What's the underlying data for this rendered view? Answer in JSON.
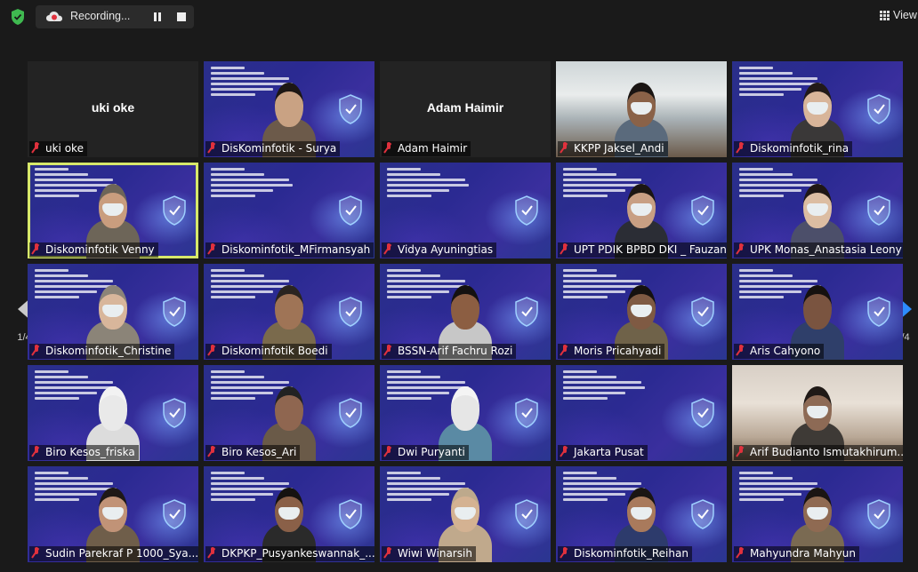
{
  "recording": {
    "label": "Recording..."
  },
  "view": {
    "label": "View"
  },
  "pagination": {
    "current": "1/4"
  },
  "tiles": [
    {
      "name": "uki oke",
      "center_name": "uki oke",
      "bg": "plain"
    },
    {
      "name": "DisKominfotik - Surya",
      "bg": "banner",
      "person": {
        "skin": "#c9a283",
        "hair": "#1d1714",
        "shirt": "#6c5a4a",
        "mask": false
      }
    },
    {
      "name": "Adam Haimir",
      "center_name": "Adam Haimir",
      "bg": "plain"
    },
    {
      "name": "KKPP Jaksel_Andi",
      "bg": "office",
      "person": {
        "skin": "#8a6248",
        "hair": "#1a1513",
        "shirt": "#5a6a7c",
        "mask": true
      }
    },
    {
      "name": "Diskominfotik_rina",
      "bg": "banner",
      "person": {
        "skin": "#d8b59a",
        "hair": "#221a18",
        "shirt": "#3a3838",
        "mask": true
      }
    },
    {
      "name": "Diskominfotik Venny",
      "bg": "banner",
      "selected": true,
      "person": {
        "skin": "#c99d7e",
        "hair": "#6d6558",
        "shirt": "#6d6558",
        "mask": true
      }
    },
    {
      "name": "Diskominfotik_MFirmansyah",
      "bg": "banner"
    },
    {
      "name": "Vidya Ayuningtias",
      "bg": "banner"
    },
    {
      "name": "UPT PDIK BPBD DKI _ Fauzan",
      "bg": "banner",
      "person": {
        "skin": "#c89f83",
        "hair": "#1b1613",
        "shirt": "#2b2d35",
        "mask": true
      }
    },
    {
      "name": "UPK Monas_Anastasia Leony",
      "bg": "banner",
      "person": {
        "skin": "#dcbda2",
        "hair": "#1f1715",
        "shirt": "#4c4f6a",
        "mask": true
      }
    },
    {
      "name": "Diskominfotik_Christine",
      "bg": "banner",
      "person": {
        "skin": "#d8b69b",
        "hair": "#8b8478",
        "shirt": "#8b8478",
        "mask": true
      }
    },
    {
      "name": "Diskominfotik Boedi",
      "bg": "banner",
      "person": {
        "skin": "#9f7456",
        "hair": "#2a2420",
        "shirt": "#7a6a4c",
        "mask": false
      }
    },
    {
      "name": "BSSN-Arif Fachru Rozi",
      "bg": "banner",
      "person": {
        "skin": "#8c5e42",
        "hair": "#141110",
        "shirt": "#c7c7c7",
        "mask": false
      }
    },
    {
      "name": "Moris Pricahyadi",
      "bg": "banner",
      "person": {
        "skin": "#7f5a43",
        "hair": "#15110f",
        "shirt": "#6f6249",
        "mask": true
      }
    },
    {
      "name": "Aris Cahyono",
      "bg": "banner",
      "person": {
        "skin": "#7a5440",
        "hair": "#15110f",
        "shirt": "#2f3f6a",
        "mask": false
      }
    },
    {
      "name": "Biro Kesos_friska",
      "bg": "banner",
      "person": {
        "skin": "#e9e9e9",
        "hair": "#f2f2f2",
        "shirt": "#dcdcdc",
        "mask": false
      }
    },
    {
      "name": "Biro Kesos_Ari",
      "bg": "banner",
      "person": {
        "skin": "#8f6650",
        "hair": "#222",
        "shirt": "#6a5a48",
        "mask": false
      }
    },
    {
      "name": "Dwi Puryanti",
      "bg": "banner",
      "person": {
        "skin": "#e6e6e6",
        "hair": "#f4f4f4",
        "shirt": "#5a8aa4",
        "mask": false
      }
    },
    {
      "name": "Jakarta Pusat",
      "bg": "banner"
    },
    {
      "name": "Arif Budianto Ismutakhirum...",
      "bg": "room",
      "person": {
        "skin": "#8d6a55",
        "hair": "#1f1916",
        "shirt": "#3e3a36",
        "mask": true
      }
    },
    {
      "name": "Sudin Parekraf P 1000_Sya...",
      "bg": "banner",
      "person": {
        "skin": "#c19377",
        "hair": "#1e1816",
        "shirt": "#6f5e4a",
        "mask": true
      }
    },
    {
      "name": "DKPKP_Pusyankeswannak_...",
      "bg": "banner",
      "person": {
        "skin": "#8a6048",
        "hair": "#151210",
        "shirt": "#2a2a2a",
        "mask": true
      }
    },
    {
      "name": "Wiwi Winarsih",
      "bg": "banner",
      "person": {
        "skin": "#d4b292",
        "hair": "#bda98c",
        "shirt": "#c0a98c",
        "mask": true
      }
    },
    {
      "name": "Diskominfotik_Reihan",
      "bg": "banner",
      "person": {
        "skin": "#a97a5c",
        "hair": "#1a1513",
        "shirt": "#2d3b6c",
        "mask": true
      }
    },
    {
      "name": "Mahyundra Mahyun",
      "bg": "banner",
      "person": {
        "skin": "#8f6a52",
        "hair": "#1a1513",
        "shirt": "#7a6a52",
        "mask": true
      }
    }
  ],
  "colors": {
    "muted_mic": "#e0313d",
    "selected_border": "#d7e86a",
    "next_arrow": "#2d8cff",
    "shield": "#3fb950"
  }
}
